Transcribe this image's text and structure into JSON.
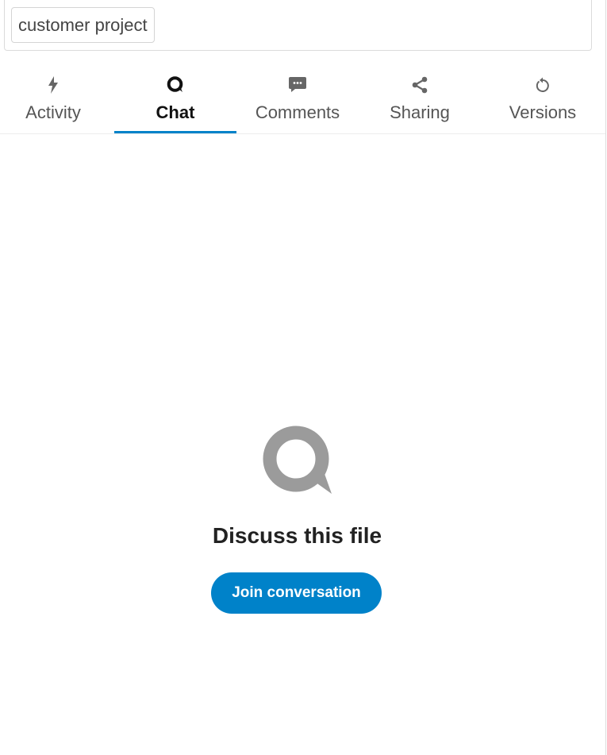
{
  "tags": {
    "chip_label": "customer project"
  },
  "tabs": [
    {
      "label": "Activity",
      "icon": "lightning-icon",
      "active": false
    },
    {
      "label": "Chat",
      "icon": "talk-bubble-icon",
      "active": true
    },
    {
      "label": "Comments",
      "icon": "comment-icon",
      "active": false
    },
    {
      "label": "Sharing",
      "icon": "share-icon",
      "active": false
    },
    {
      "label": "Versions",
      "icon": "restore-icon",
      "active": false
    }
  ],
  "empty_state": {
    "icon": "talk-bubble-icon",
    "title": "Discuss this file",
    "button_label": "Join conversation"
  },
  "colors": {
    "accent": "#0082c9",
    "icon_gray": "#9b9b9b"
  }
}
